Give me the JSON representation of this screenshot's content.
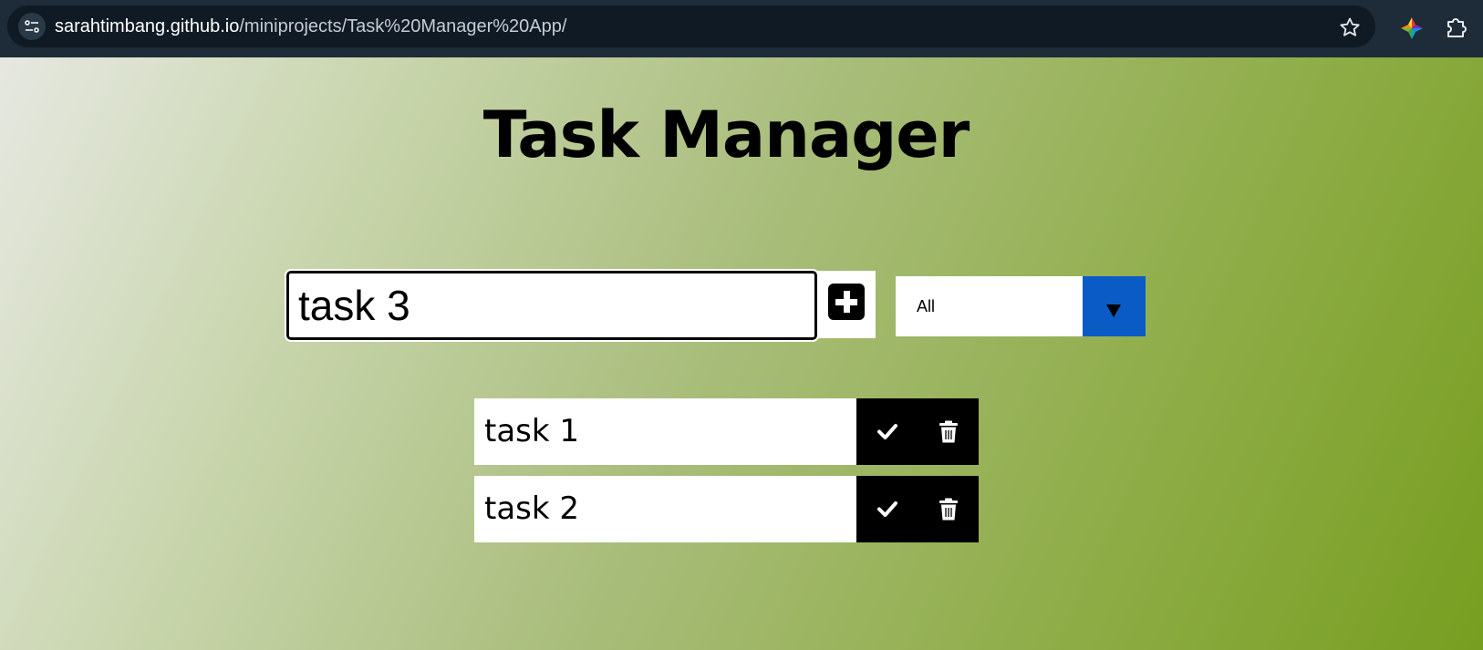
{
  "browser": {
    "url_host": "sarahtimbang.github.io",
    "url_path": "/miniprojects/Task%20Manager%20App/",
    "icons": [
      "site-info-icon",
      "star-icon",
      "color-extension-icon",
      "puzzle-extension-icon"
    ]
  },
  "app": {
    "title": "Task Manager",
    "input_value": "task 3",
    "add_icon": "plus-square-icon",
    "filter": {
      "selected": "All",
      "arrow_icon": "dropdown-arrow-icon"
    },
    "todos": [
      {
        "text": "task 1",
        "actions": [
          "check-icon",
          "trash-icon"
        ]
      },
      {
        "text": "task 2",
        "actions": [
          "check-icon",
          "trash-icon"
        ]
      }
    ]
  },
  "colors": {
    "chrome": "#1e2b38",
    "filter_accent": "#0b5bc7",
    "gradient_start": "#e6e8e1",
    "gradient_end": "#779e20"
  }
}
